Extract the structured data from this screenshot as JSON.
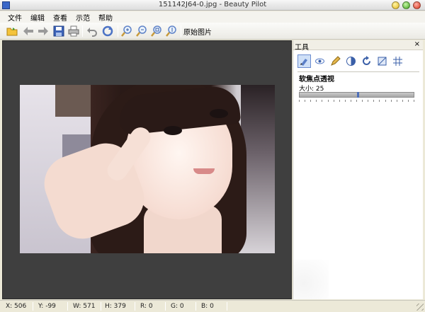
{
  "window": {
    "title": "151142J64-0.jpg - Beauty Pilot"
  },
  "menu": {
    "items": [
      "文件",
      "编辑",
      "查看",
      "示范",
      "帮助"
    ]
  },
  "toolbar": {
    "icons": [
      "open-folder-icon",
      "back-arrow-icon",
      "forward-arrow-icon",
      "save-icon",
      "print-icon",
      "undo-icon",
      "redo-icon",
      "zoom-in-icon",
      "zoom-out-icon",
      "zoom-fit-icon",
      "zoom-actual-icon"
    ],
    "original_label": "原始图片"
  },
  "panel": {
    "title": "工具",
    "close_glyph": "×",
    "tools": [
      "brush-tool-icon",
      "eye-tool-icon",
      "pencil-tool-icon",
      "contrast-tool-icon",
      "rotate-tool-icon",
      "crop-tool-icon",
      "grid-tool-icon"
    ],
    "active_tool_name": "软焦点透视",
    "size_label": "大小: 25",
    "size_value": 25,
    "size_fraction": 0.5
  },
  "status": {
    "x": "X: 506",
    "y": "Y: -99",
    "w": "W: 571",
    "h": "H: 379",
    "r": "R: 0",
    "g": "G: 0",
    "b": "B: 0"
  }
}
